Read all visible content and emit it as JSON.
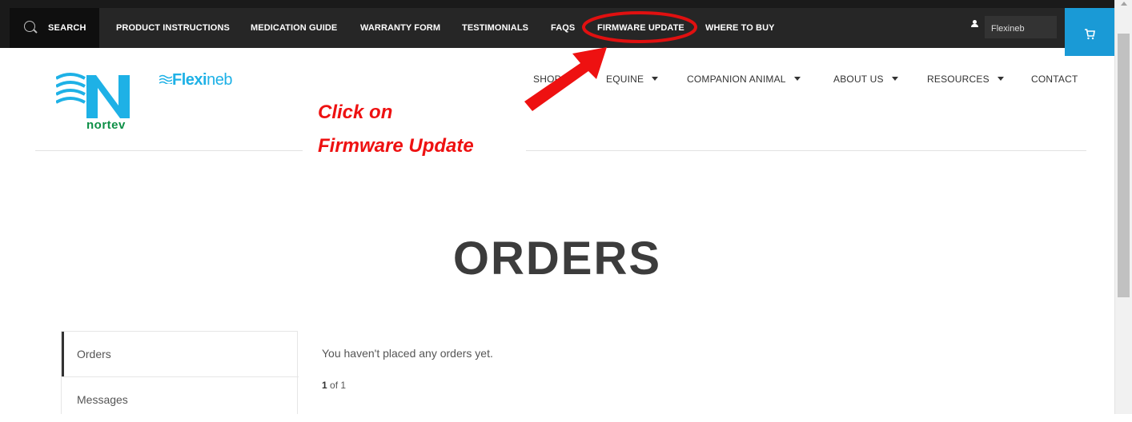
{
  "topnav": {
    "search_label": "SEARCH",
    "items": [
      {
        "label": "PRODUCT INSTRUCTIONS"
      },
      {
        "label": "MEDICATION GUIDE"
      },
      {
        "label": "WARRANTY FORM"
      },
      {
        "label": "TESTIMONIALS"
      },
      {
        "label": "FAQS"
      },
      {
        "label": "FIRMWARE UPDATE"
      },
      {
        "label": "WHERE TO BUY"
      }
    ],
    "user_value": "Flexineb",
    "highlight_color": "#e01010",
    "cart_color": "#1a9ad6"
  },
  "logo": {
    "brand_text": "nortev",
    "product_bold": "Flexi",
    "product_thin": "neb"
  },
  "mainnav": {
    "items": [
      {
        "label": "SHOP"
      },
      {
        "label": "EQUINE"
      },
      {
        "label": "COMPANION ANIMAL"
      },
      {
        "label": "ABOUT US"
      },
      {
        "label": "RESOURCES"
      },
      {
        "label": "CONTACT"
      }
    ]
  },
  "annotation": {
    "line1": "Click on",
    "line2": "Firmware Update",
    "color": "#ee1111"
  },
  "page": {
    "title": "ORDERS"
  },
  "account_nav": {
    "items": [
      {
        "label": "Orders"
      },
      {
        "label": "Messages"
      }
    ]
  },
  "orders": {
    "empty_message": "You haven't placed any orders yet.",
    "pager_current": "1",
    "pager_text": " of 1"
  },
  "icons": {
    "search": "search-icon",
    "user": "user-icon",
    "cart": "cart-icon",
    "arrow": "arrow-icon"
  }
}
